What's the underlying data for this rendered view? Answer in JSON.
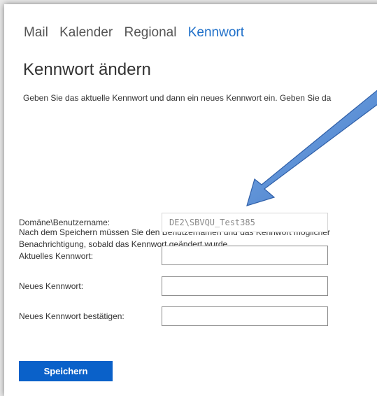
{
  "nav": {
    "items": [
      "Mail",
      "Kalender",
      "Regional",
      "Kennwort"
    ],
    "active": "Kennwort"
  },
  "page": {
    "title": "Kennwort ändern",
    "intro": "Geben Sie das aktuelle Kennwort und dann ein neues Kennwort ein. Geben Sie da",
    "info_line1": "Nach dem Speichern müssen Sie den Benutzernamen und das Kennwort möglicher",
    "info_line2": "Benachrichtigung, sobald das Kennwort geändert wurde."
  },
  "form": {
    "domain_label": "Domäne\\Benutzername:",
    "domain_value": "DE2\\SBVQU_Test385",
    "current_label": "Aktuelles Kennwort:",
    "new_label": "Neues Kennwort:",
    "confirm_label": "Neues Kennwort bestätigen:",
    "save_label": "Speichern"
  },
  "colors": {
    "accent": "#1e6fc9",
    "button": "#0a61c9",
    "arrow": "#5b8fd6"
  }
}
